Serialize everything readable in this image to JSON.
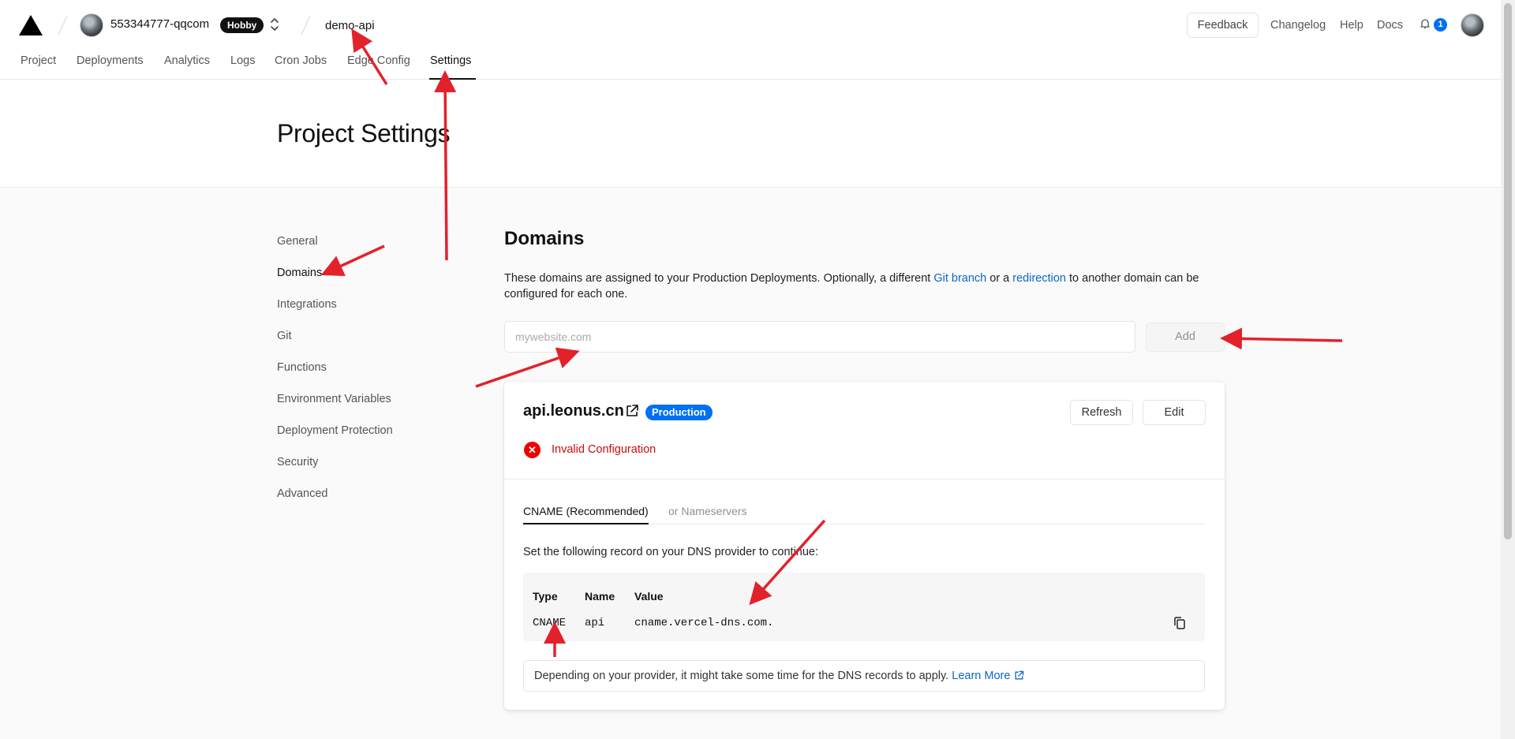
{
  "header": {
    "team_name": "553344777-qqcom",
    "plan_badge": "Hobby",
    "project_name": "demo-api",
    "switcher_glyph": "⌃⌄",
    "tabs": [
      {
        "label": "Project"
      },
      {
        "label": "Deployments"
      },
      {
        "label": "Analytics"
      },
      {
        "label": "Logs"
      },
      {
        "label": "Cron Jobs"
      },
      {
        "label": "Edge Config"
      },
      {
        "label": "Settings",
        "active": true
      }
    ],
    "feedback_label": "Feedback",
    "links": [
      "Changelog",
      "Help",
      "Docs"
    ],
    "notification_count": "1"
  },
  "page": {
    "title": "Project Settings"
  },
  "sidebar": {
    "items": [
      {
        "label": "General"
      },
      {
        "label": "Domains",
        "active": true
      },
      {
        "label": "Integrations"
      },
      {
        "label": "Git"
      },
      {
        "label": "Functions"
      },
      {
        "label": "Environment Variables"
      },
      {
        "label": "Deployment Protection"
      },
      {
        "label": "Security"
      },
      {
        "label": "Advanced"
      }
    ]
  },
  "domains": {
    "title": "Domains",
    "description_before": "These domains are assigned to your Production Deployments. Optionally, a different ",
    "git_branch_link": "Git branch",
    "description_middle": " or a ",
    "redirection_link": "redirection",
    "description_after": " to another domain can be configured for each one.",
    "input_value": "",
    "input_placeholder": "mywebsite.com",
    "add_label": "Add"
  },
  "domain_card": {
    "domain": "api.leonus.cn",
    "environment_badge": "Production",
    "refresh_label": "Refresh",
    "edit_label": "Edit",
    "error_glyph": "✕",
    "status_text": "Invalid Configuration",
    "tabs": [
      {
        "label": "CNAME (Recommended)",
        "active": true
      },
      {
        "label": "or Nameservers"
      }
    ],
    "instruction": "Set the following record on your DNS provider to continue:",
    "record": {
      "headers": [
        "Type",
        "Name",
        "Value"
      ],
      "values": [
        "CNAME",
        "api",
        "cname.vercel-dns.com."
      ]
    },
    "note_text": "Depending on your provider, it might take some time for the DNS records to apply. ",
    "learn_more": "Learn More"
  },
  "colors": {
    "accent": "#0070f3",
    "link": "#0b67c4",
    "error": "#e00000",
    "annotation_arrow": "#e3212b"
  },
  "icons": [
    "vercel-logo-icon",
    "chevron-updown-icon",
    "bell-icon",
    "external-link-icon",
    "error-x-icon",
    "copy-icon"
  ]
}
